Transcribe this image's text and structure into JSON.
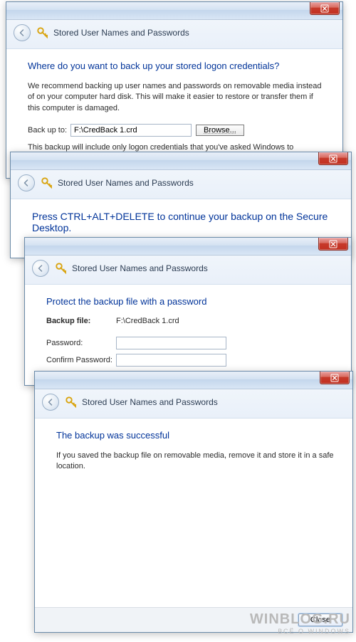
{
  "common": {
    "window_title": "Stored User Names and Passwords",
    "close_label": "Close"
  },
  "w1": {
    "heading": "Where do you want to back up your stored logon credentials?",
    "body": "We recommend backing up user names and passwords on removable media instead of on your computer hard disk. This will make it easier to restore or transfer them if this computer is damaged.",
    "backup_to_label": "Back up to:",
    "backup_to_value": "F:\\CredBack 1.crd",
    "browse_label": "Browse...",
    "note": "This backup will include only logon credentials that you've asked Windows to remember. It will not include any credentials saved in your web browser."
  },
  "w2": {
    "heading": "Press CTRL+ALT+DELETE to continue your backup on the Secure Desktop."
  },
  "w3": {
    "heading": "Protect the backup file with a password",
    "backup_file_label": "Backup file:",
    "backup_file_value": "F:\\CredBack 1.crd",
    "password_label": "Password:",
    "password_value": "",
    "confirm_label": "Confirm Password:",
    "confirm_value": ""
  },
  "w4": {
    "heading": "The backup was successful",
    "body": "If you saved the backup file on removable media, remove it and store it in a safe location.",
    "close_btn": "Close"
  },
  "watermark": {
    "big": "WINBLOG.RU",
    "small": "ВСЁ О WINDOWS"
  }
}
